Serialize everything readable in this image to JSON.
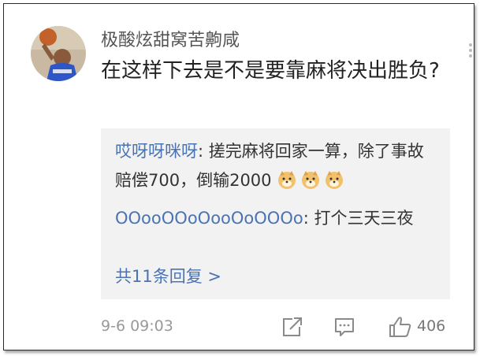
{
  "comment": {
    "username": "极酸炫甜窝苦齁咸",
    "text": "在这样下去是不是要靠麻将决出胜负?",
    "timestamp": "9-6 09:03",
    "like_count": "406"
  },
  "replies": [
    {
      "name": "哎呀呀咪呀",
      "text": ": 搓完麻将回家一算，除了事故赔偿700，倒输2000",
      "emojis": [
        "doge-emoji",
        "doge-emoji",
        "doge-emoji"
      ]
    },
    {
      "name": "OOooOOoOooOoOOOo",
      "text": ": 打个三天三夜"
    }
  ],
  "more_replies_label": "共11条回复 >",
  "icons": {
    "share": "share-icon",
    "comment": "comment-icon",
    "like": "thumbs-up-icon",
    "more": "more-vertical-icon"
  },
  "colors": {
    "link": "#4a73b3",
    "reply_bg": "#f2f2f2",
    "muted": "#999999"
  }
}
